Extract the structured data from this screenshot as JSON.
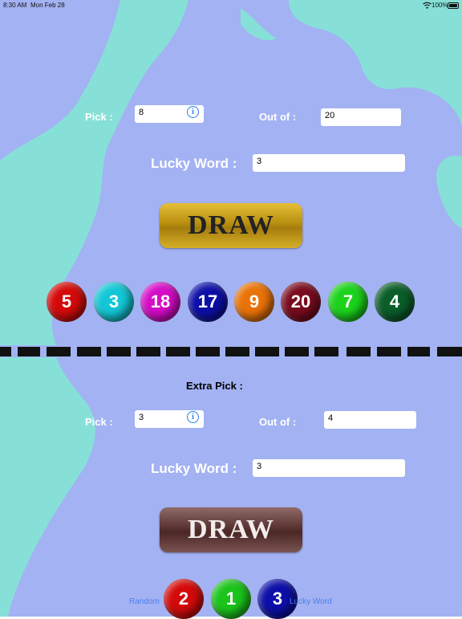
{
  "status_bar": {
    "time": "8:30 AM",
    "date": "Mon Feb 28",
    "battery": "100%"
  },
  "main_draw": {
    "pick_label": "Pick :",
    "pick_value": "8",
    "out_of_label": "Out of :",
    "out_of_value": "20",
    "lucky_word_label": "Lucky Word :",
    "lucky_word_value": "3",
    "draw_label": "DRAW",
    "balls": [
      {
        "number": "5",
        "color": "#d40a0a"
      },
      {
        "number": "3",
        "color": "#13c7d6"
      },
      {
        "number": "18",
        "color": "#d60bc8"
      },
      {
        "number": "17",
        "color": "#0d0fa8"
      },
      {
        "number": "9",
        "color": "#ea7308"
      },
      {
        "number": "20",
        "color": "#7a0b1e"
      },
      {
        "number": "7",
        "color": "#1bd31b"
      },
      {
        "number": "4",
        "color": "#0b5e2a"
      }
    ]
  },
  "extra_draw": {
    "title": "Extra Pick :",
    "pick_label": "Pick :",
    "pick_value": "3",
    "out_of_label": "Out of :",
    "out_of_value": "4",
    "lucky_word_label": "Lucky Word :",
    "lucky_word_value": "3",
    "draw_label": "DRAW",
    "balls": [
      {
        "number": "2",
        "color": "#d40a0a"
      },
      {
        "number": "1",
        "color": "#1bc41b"
      },
      {
        "number": "3",
        "color": "#0d0fa8"
      }
    ]
  },
  "tab_bar": {
    "random_label": "Random",
    "lucky_word_label": "Lucky Word"
  },
  "colors": {
    "background": "#a3b2f2",
    "background_wave": "#86e0d8",
    "accent": "#2a7df0"
  },
  "icons": {
    "info": "info-circle-icon",
    "wifi": "wifi-icon",
    "battery": "battery-icon"
  }
}
